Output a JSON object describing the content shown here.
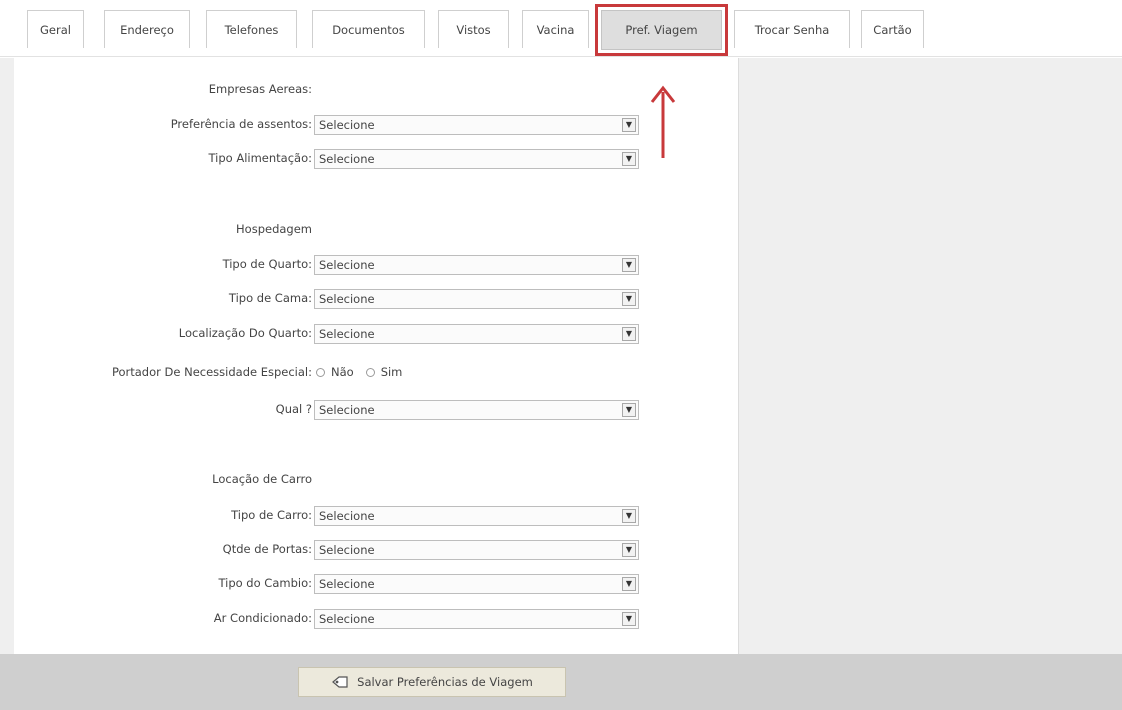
{
  "tabs": [
    {
      "label": "Geral"
    },
    {
      "label": "Endereço"
    },
    {
      "label": "Telefones"
    },
    {
      "label": "Documentos"
    },
    {
      "label": "Vistos"
    },
    {
      "label": "Vacina"
    },
    {
      "label": "Pref. Viagem"
    },
    {
      "label": "Trocar Senha"
    },
    {
      "label": "Cartão"
    }
  ],
  "active_tab": "Pref. Viagem",
  "airlines": {
    "title": "Empresas Aereas:",
    "seat_label": "Preferência de assentos:",
    "seat_value": "Selecione",
    "meal_label": "Tipo Alimentação:",
    "meal_value": "Selecione"
  },
  "lodging": {
    "title": "Hospedagem",
    "room_type_label": "Tipo de Quarto:",
    "room_type_value": "Selecione",
    "bed_type_label": "Tipo de Cama:",
    "bed_type_value": "Selecione",
    "room_location_label": "Localização Do Quarto:",
    "room_location_value": "Selecione",
    "special_needs_label": "Portador De Necessidade Especial:",
    "special_needs_no": "Não",
    "special_needs_yes": "Sim",
    "which_label": "Qual ?",
    "which_value": "Selecione"
  },
  "car_rental": {
    "title": "Locação de Carro",
    "car_type_label": "Tipo de Carro:",
    "car_type_value": "Selecione",
    "doors_label": "Qtde de Portas:",
    "doors_value": "Selecione",
    "gearbox_label": "Tipo do Cambio:",
    "gearbox_value": "Selecione",
    "ac_label": "Ar Condicionado:",
    "ac_value": "Selecione"
  },
  "save_button": {
    "label": "Salvar Preferências de Viagem",
    "icon": "save-tag-icon"
  },
  "colors": {
    "highlight": "#c8393b",
    "panel_gray": "#efefef",
    "bar_gray": "#cfcfcf",
    "button_bg": "#ece9dc"
  }
}
